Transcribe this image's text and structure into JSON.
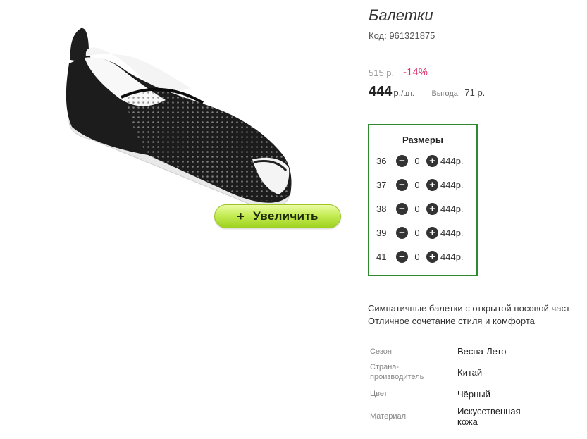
{
  "product": {
    "title": "Балетки",
    "code": "Код: 961321875",
    "zoom_label": "Увеличить",
    "zoom_plus": "+"
  },
  "pricing": {
    "old_price": "515 р.",
    "discount": "-14%",
    "price": "444",
    "currency": "р.",
    "per_unit": "/шт.",
    "savings_label": "Выгода:",
    "savings_value": "71 р."
  },
  "sizes": {
    "title": "Размеры",
    "minus_symbol": "−",
    "plus_symbol": "+",
    "rows": [
      {
        "size": "36",
        "qty": "0",
        "price": "444р."
      },
      {
        "size": "37",
        "qty": "0",
        "price": "444р."
      },
      {
        "size": "38",
        "qty": "0",
        "price": "444р."
      },
      {
        "size": "39",
        "qty": "0",
        "price": "444р."
      },
      {
        "size": "41",
        "qty": "0",
        "price": "444р."
      }
    ]
  },
  "description": {
    "line1": "Симпатичные балетки с открытой носовой част",
    "line2": "Отличное сочетание стиля и комфорта"
  },
  "specs": [
    {
      "label": "Сезон",
      "value": "Весна-Лето"
    },
    {
      "label": "Страна-производитель",
      "value": "Китай"
    },
    {
      "label": "Цвет",
      "value": "Чёрный"
    },
    {
      "label": "Материал",
      "value": "Искусственная кожа"
    }
  ],
  "colors": {
    "accent_green": "#2f8a2f",
    "discount": "#d9346a",
    "button_green": "#9fd21f"
  },
  "icons": {
    "minus": "minus-circle-icon",
    "plus": "plus-circle-icon"
  }
}
